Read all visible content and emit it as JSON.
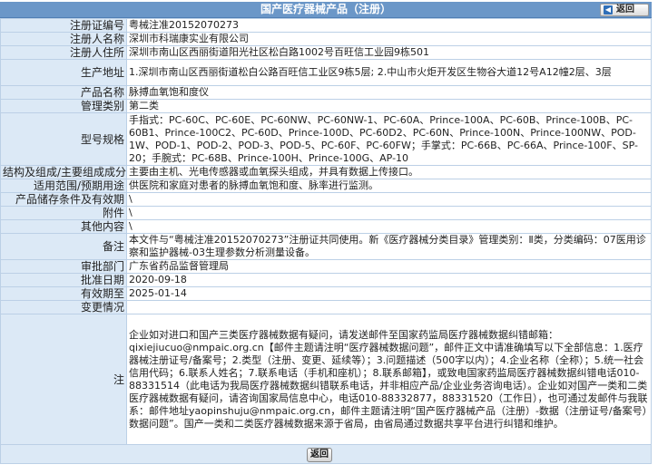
{
  "header": {
    "title": "国产医疗器械产品（注册）",
    "back_label": "返回"
  },
  "rows": [
    {
      "label": "注册证编号",
      "value": "粤械注准20152070273"
    },
    {
      "label": "注册人名称",
      "value": "深圳市科瑞康实业有限公司"
    },
    {
      "label": "注册人住所",
      "value": "深圳市南山区西丽街道阳光社区松白路1002号百旺信工业园9栋501"
    },
    {
      "label": "生产地址",
      "value": "1.深圳市南山区西丽街道松白公路百旺信工业区9栋5层; 2.中山市火炬开发区生物谷大道12号A12幢2层、3层"
    },
    {
      "label": "产品名称",
      "value": "脉搏血氧饱和度仪"
    },
    {
      "label": "管理类别",
      "value": "第二类"
    },
    {
      "label": "型号规格",
      "value": "手指式：PC-60C、PC-60E、PC-60NW、PC-60NW-1、PC-60A、Prince-100A、PC-60B、Prince-100B、PC-60B1、Prince-100C2、PC-60D、Prince-100D、PC-60D2、PC-60N、Prince-100N、Prince-100NW、POD-1W、POD-1、POD-2、POD-3、POD-5、PC-60F、PC-60FW；手掌式：PC-66B、PC-66A、Prince-100F、SP-20；手腕式：PC-68B、Prince-100H、Prince-100G、AP-10"
    },
    {
      "label": "结构及组成/主要组成成分",
      "value": "主要由主机、光电传感器或血氧探头组成，并具有数据上传接口。"
    },
    {
      "label": "适用范围/预期用途",
      "value": "供医院和家庭对患者的脉搏血氧饱和度、脉率进行监测。"
    },
    {
      "label": "产品储存条件及有效期",
      "value": "\\"
    },
    {
      "label": "附件",
      "value": "\\"
    },
    {
      "label": "其他内容",
      "value": "\\"
    },
    {
      "label": "备注",
      "value": "本文件与“粤械注准20152070273”注册证共同使用。新《医疗器械分类目录》管理类别：Ⅱ类，分类编码：07医用诊察和监护器械-03生理参数分析测量设备。"
    },
    {
      "label": "审批部门",
      "value": "广东省药品监督管理局"
    },
    {
      "label": "批准日期",
      "value": "2020-09-18"
    },
    {
      "label": "有效期至",
      "value": "2025-01-14"
    },
    {
      "label": "变更情况",
      "value": ""
    },
    {
      "label": "注",
      "value": "企业如对进口和国产三类医疗器械数据有疑问，请发送邮件至国家药监局医疗器械数据纠错邮箱：qixiejiucuo@nmpaic.org.cn【邮件主题请注明“医疗器械数据问题”，邮件正文中请准确填写以下全部信息：1.医疗器械注册证号/备案号；2.类型（注册、变更、延续等）；3.问题描述（500字以内）；4.企业名称（全称）；5.统一社会信用代码；6.联系人姓名；7.联系电话（手机和座机）；8.联系邮箱】，或致电国家药监局医疗器械数据纠错电话010-88331514（此电话为我局医疗器械数据纠错联系电话，并非相应产品/企业业务咨询电话）。企业如对国产一类和二类医疗器械数据有疑问，请咨询国家局信息中心，电话010-88332877，88331520（工作日），也可通过发邮件与我联系：邮件地址yaopinshuju@nmpaic.org.cn，邮件主题请注明“国产医疗器械产品（注册）-数据（注册证号/备案号）数据问题”。国产一类和二类医疗器械数据来源于省局，由省局通过数据共享平台进行纠错和维护。"
    }
  ],
  "footer": {
    "back_label": "返回"
  },
  "icons": {
    "back_arrow": "back-arrow-icon"
  },
  "colors": {
    "title_bar": "#6b97c8",
    "label_bg": "#dce9f6",
    "border": "#bcd0e6"
  }
}
